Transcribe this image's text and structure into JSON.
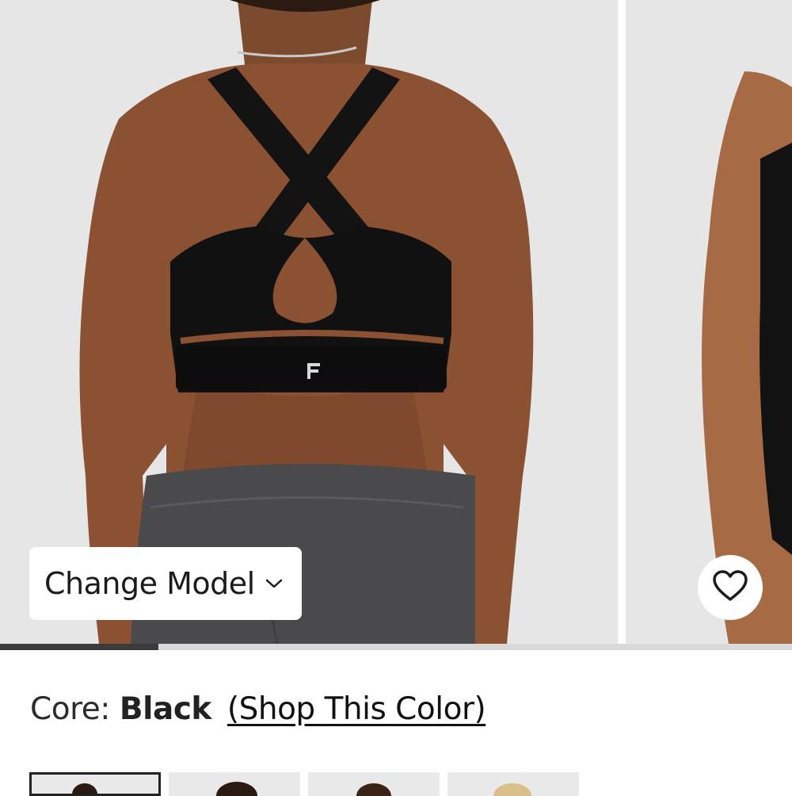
{
  "carousel": {
    "slides": [
      {
        "name": "model-back-view"
      },
      {
        "name": "model-side-view"
      }
    ],
    "change_model_label": "Change Model",
    "favorite_icon": "heart-outline-icon",
    "progress_fraction": 0.2
  },
  "color": {
    "prefix": "Core:",
    "value": "Black",
    "shop_link": "(Shop This Color)"
  },
  "thumbnails": [
    {
      "name": "thumbnail-1",
      "selected": true
    },
    {
      "name": "thumbnail-2",
      "selected": false
    },
    {
      "name": "thumbnail-3",
      "selected": false
    },
    {
      "name": "thumbnail-4",
      "selected": false
    }
  ],
  "colors": {
    "background": "#e6e6e7",
    "bra": "#111111",
    "skin": "#8a5233",
    "leggings": "#4a4a4d",
    "progress_fill": "#3b3b3b",
    "progress_track": "#d9d9d9"
  }
}
